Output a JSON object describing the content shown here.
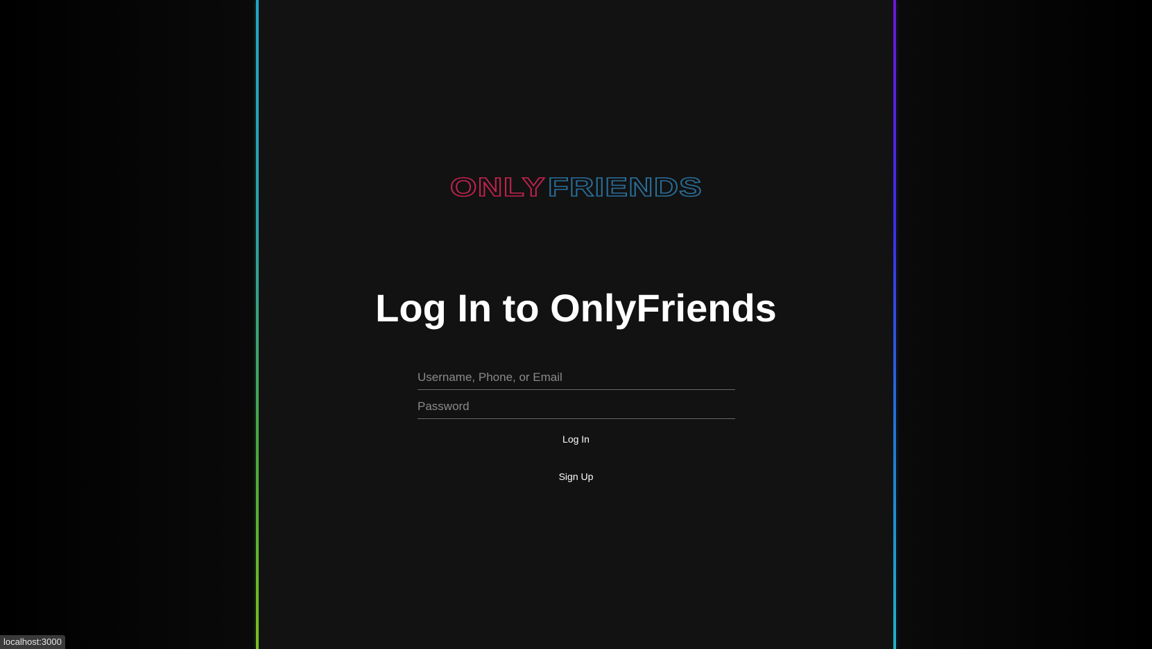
{
  "logo": {
    "text_part1": "ONLY",
    "text_part2": "FRIENDS",
    "color_part1": "#c0234f",
    "color_part2": "#2a6f9b"
  },
  "login": {
    "title": "Log In to OnlyFriends",
    "username_placeholder": "Username, Phone, or Email",
    "password_placeholder": "Password",
    "login_label": "Log In",
    "signup_label": "Sign Up"
  },
  "status_bar": {
    "url": "localhost:3000"
  },
  "colors": {
    "panel_bg": "#121212",
    "rail_left_top": "#1fa6c9",
    "rail_left_bottom": "#7bbf1d",
    "rail_right_top": "#6a18d6",
    "rail_right_bottom": "#1fb3c7"
  }
}
